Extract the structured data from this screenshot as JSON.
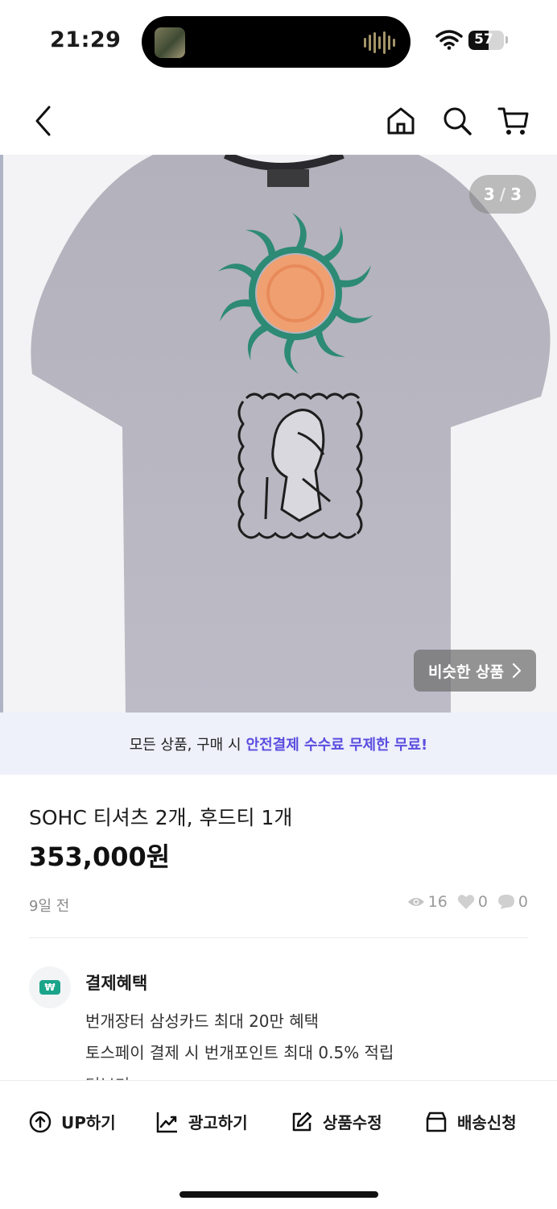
{
  "status_bar": {
    "time": "21:29",
    "battery_level": "57",
    "battery_fraction": 0.57
  },
  "nav": {
    "back_icon": "chevron-left-icon",
    "home_icon": "home-icon",
    "search_icon": "search-icon",
    "cart_icon": "cart-icon"
  },
  "product_image": {
    "counter_current": "3",
    "counter_separator": "/",
    "counter_total": "3",
    "similar_label": "비슷한 상품"
  },
  "promo": {
    "text": "모든 상품, 구매 시",
    "highlight": "안전결제 수수료 무제한 무료!",
    "highlight_color": "#5a4de0"
  },
  "product": {
    "title": "SOHC 티셔츠 2개, 후드티 1개",
    "price": "353,000원",
    "posted": "9일 전",
    "views": "16",
    "likes": "0",
    "chats": "0"
  },
  "benefits": {
    "title": "결제혜택",
    "icon_label": "₩",
    "lines": [
      "번개장터 삼성카드 최대 20만 혜택",
      "토스페이 결제 시 번개포인트 최대 0.5% 적립"
    ],
    "more": "더보기"
  },
  "actions": [
    {
      "label": "UP하기",
      "icon": "arrow-up-circle-icon"
    },
    {
      "label": "광고하기",
      "icon": "chart-trend-icon"
    },
    {
      "label": "상품수정",
      "icon": "edit-icon"
    },
    {
      "label": "배송신청",
      "icon": "box-icon"
    }
  ]
}
